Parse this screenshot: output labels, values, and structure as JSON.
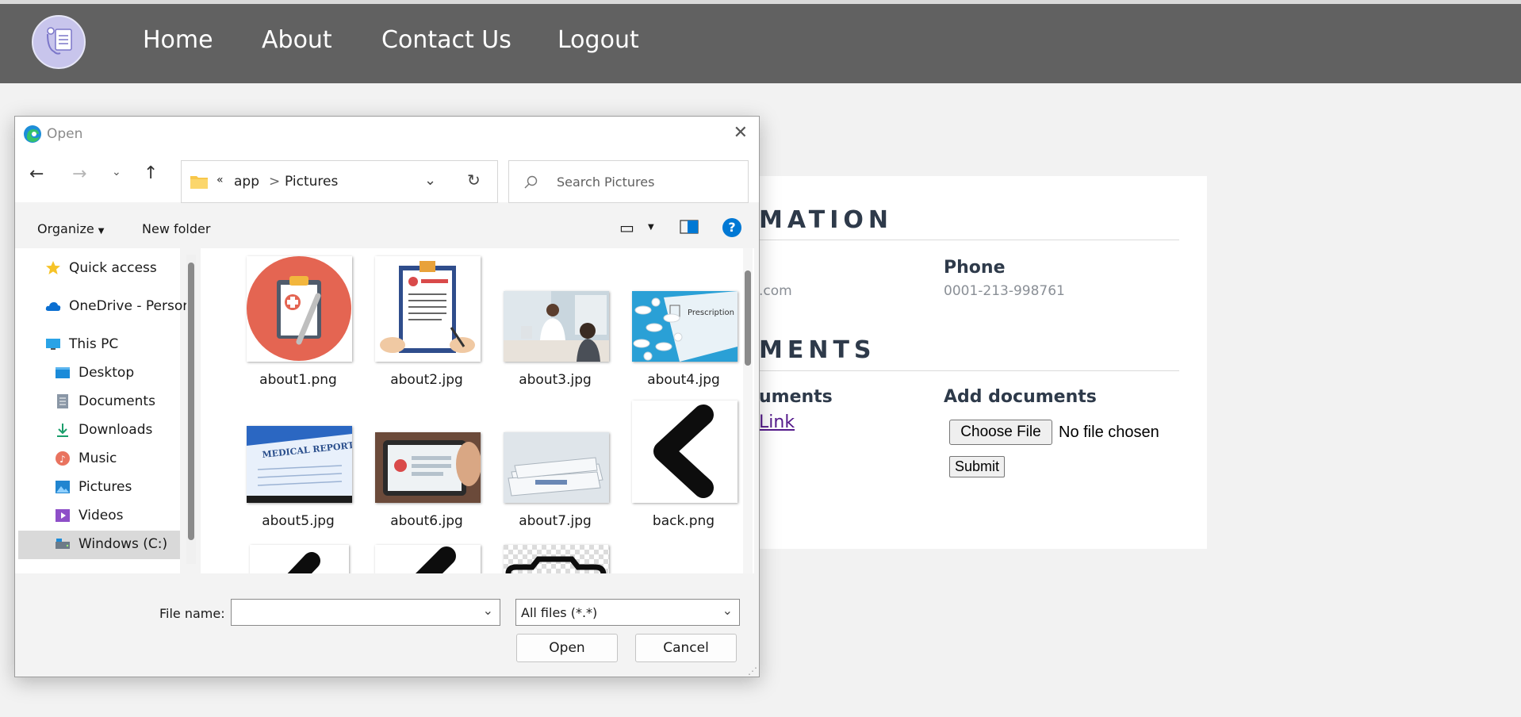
{
  "nav": {
    "links": [
      "Home",
      "About",
      "Contact Us",
      "Logout"
    ]
  },
  "card": {
    "info_title_visible": "MATION",
    "email_value_partial": ".com",
    "phone_label": "Phone",
    "phone_value": "0001-213-998761",
    "docs_title_visible": "MENTS",
    "docs_label_partial": "uments",
    "link_text_partial": "Link",
    "add_docs_label": "Add documents",
    "choose_file_label": "Choose File",
    "no_file_text": "No file chosen",
    "submit_label": "Submit"
  },
  "dialog": {
    "title": "Open",
    "address": {
      "overflow": "«",
      "segments": [
        "app",
        "Pictures"
      ],
      "separator": ">"
    },
    "search_placeholder": "Search Pictures",
    "commands": {
      "organize": "Organize",
      "new_folder": "New folder",
      "help": "?"
    },
    "nav_items": [
      {
        "label": "Quick access",
        "icon": "star-icon"
      },
      {
        "label": "OneDrive - Persor",
        "icon": "cloud-icon"
      },
      {
        "label": "This PC",
        "icon": "monitor-icon"
      },
      {
        "label": "Desktop",
        "icon": "desktop-folder-icon"
      },
      {
        "label": "Documents",
        "icon": "documents-icon"
      },
      {
        "label": "Downloads",
        "icon": "download-icon"
      },
      {
        "label": "Music",
        "icon": "music-icon"
      },
      {
        "label": "Pictures",
        "icon": "pictures-icon"
      },
      {
        "label": "Videos",
        "icon": "videos-icon"
      },
      {
        "label": "Windows (C:)",
        "icon": "drive-icon",
        "selected": true
      }
    ],
    "files": [
      "about1.png",
      "about2.jpg",
      "about3.jpg",
      "about4.jpg",
      "about5.jpg",
      "about6.jpg",
      "about7.jpg",
      "back.png"
    ],
    "file_name_label": "File name:",
    "file_name_value": "",
    "filter_value": "All files (*.*)",
    "open_label": "Open",
    "cancel_label": "Cancel"
  },
  "colors": {
    "navbar": "#616161",
    "page_bg": "#f2f2f2",
    "heading": "#2e3a4a",
    "link": "#551a8b",
    "accent_blue": "#0078d4"
  }
}
